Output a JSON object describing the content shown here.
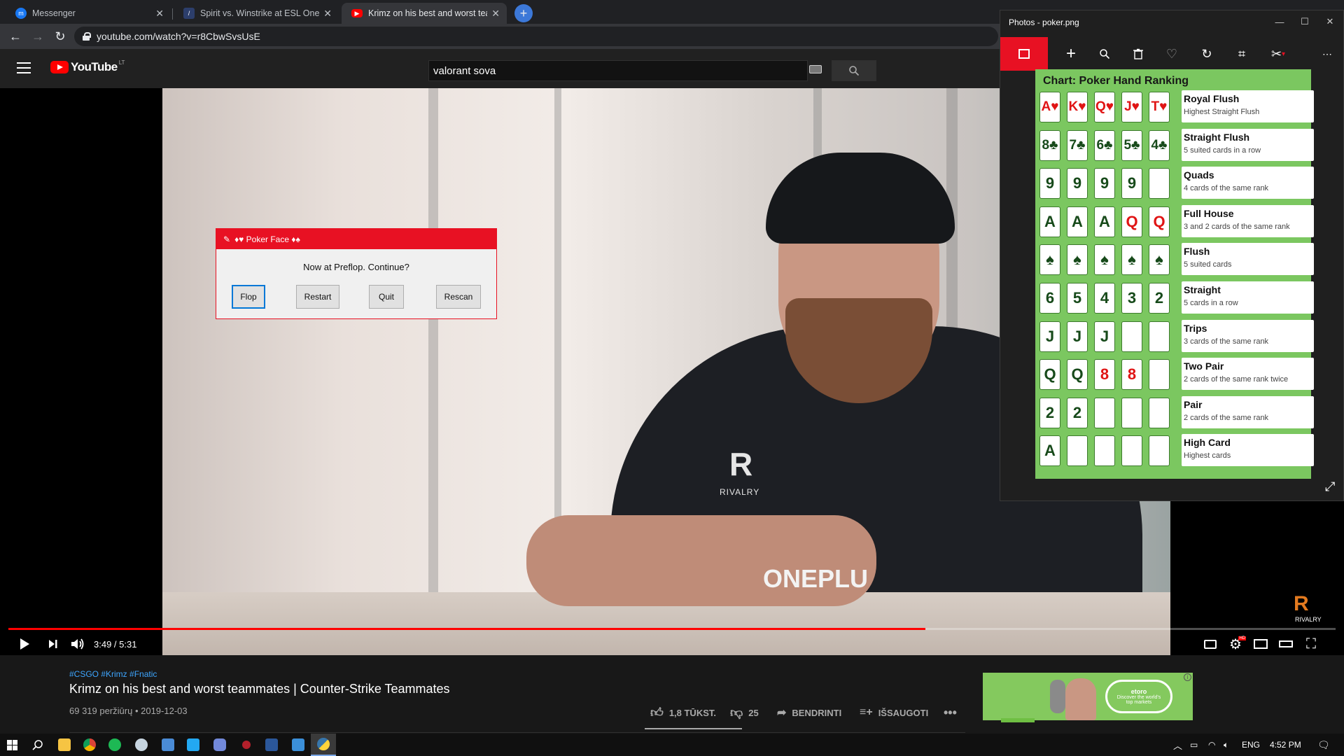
{
  "browser": {
    "tabs": [
      {
        "title": "Messenger",
        "icon": "messenger-icon",
        "active": false
      },
      {
        "title": "Spirit vs. Winstrike at ESL One: R",
        "icon": "hltv-icon",
        "active": false
      },
      {
        "title": "Krimz on his best and worst team",
        "icon": "youtube-icon",
        "active": true
      }
    ],
    "url": "youtube.com/watch?v=r8CbwSvsUsE"
  },
  "youtube": {
    "logo_text": "YouTube",
    "region": "LT",
    "search_value": "valorant sova",
    "player": {
      "time": "3:49 / 5:31",
      "progress": 0.691,
      "shirt_logo": "R",
      "shirt_text": "RIVALRY",
      "shirt_sponsor": "ONEPLU",
      "watermark_logo": "R",
      "watermark_text": "RIVALRY"
    },
    "video": {
      "tags": "#CSGO #Krimz #Fnatic",
      "title": "Krimz on his best and worst teammates | Counter-Strike Teammates",
      "meta": "69 319 peržiūrų • 2019-12-03",
      "likes": "1,8 TŪKST.",
      "dislikes": "25",
      "share_label": "BENDRINTI",
      "save_label": "IŠSAUGOTI"
    },
    "ad": {
      "brand": "etoro",
      "tagline": "Discover the world's top markets"
    }
  },
  "dialog": {
    "title": "♦♥ Poker Face ♦♠",
    "message": "Now at Preflop. Continue?",
    "buttons": [
      "Flop",
      "Restart",
      "Quit",
      "Rescan"
    ]
  },
  "photos": {
    "title": "Photos - poker.png",
    "chart_title": "Chart: Poker Hand Ranking",
    "hands": [
      {
        "name": "Royal Flush",
        "desc": "Highest Straight Flush",
        "cards": [
          {
            "t": "A♥",
            "red": true
          },
          {
            "t": "K♥",
            "red": true
          },
          {
            "t": "Q♥",
            "red": true
          },
          {
            "t": "J♥",
            "red": true
          },
          {
            "t": "T♥",
            "red": true
          }
        ]
      },
      {
        "name": "Straight Flush",
        "desc": "5 suited cards in a row",
        "cards": [
          {
            "t": "8♣",
            "red": false
          },
          {
            "t": "7♣",
            "red": false
          },
          {
            "t": "6♣",
            "red": false
          },
          {
            "t": "5♣",
            "red": false
          },
          {
            "t": "4♣",
            "red": false
          }
        ]
      },
      {
        "name": "Quads",
        "desc": "4 cards of the same rank",
        "cards": [
          {
            "t": "9",
            "red": false
          },
          {
            "t": "9",
            "red": false
          },
          {
            "t": "9",
            "red": false
          },
          {
            "t": "9",
            "red": false
          },
          {
            "t": "",
            "red": false
          }
        ]
      },
      {
        "name": "Full House",
        "desc": "3 and 2 cards of the same rank",
        "cards": [
          {
            "t": "A",
            "red": false
          },
          {
            "t": "A",
            "red": false
          },
          {
            "t": "A",
            "red": false
          },
          {
            "t": "Q",
            "red": true
          },
          {
            "t": "Q",
            "red": true
          }
        ]
      },
      {
        "name": "Flush",
        "desc": "5 suited cards",
        "cards": [
          {
            "t": "♠",
            "red": false
          },
          {
            "t": "♠",
            "red": false
          },
          {
            "t": "♠",
            "red": false
          },
          {
            "t": "♠",
            "red": false
          },
          {
            "t": "♠",
            "red": false
          }
        ]
      },
      {
        "name": "Straight",
        "desc": "5 cards in a row",
        "cards": [
          {
            "t": "6",
            "red": false
          },
          {
            "t": "5",
            "red": false
          },
          {
            "t": "4",
            "red": false
          },
          {
            "t": "3",
            "red": false
          },
          {
            "t": "2",
            "red": false
          }
        ]
      },
      {
        "name": "Trips",
        "desc": "3 cards of the same rank",
        "cards": [
          {
            "t": "J",
            "red": false
          },
          {
            "t": "J",
            "red": false
          },
          {
            "t": "J",
            "red": false
          },
          {
            "t": "",
            "red": false
          },
          {
            "t": "",
            "red": false
          }
        ]
      },
      {
        "name": "Two Pair",
        "desc": "2 cards of the same rank twice",
        "cards": [
          {
            "t": "Q",
            "red": false
          },
          {
            "t": "Q",
            "red": false
          },
          {
            "t": "8",
            "red": true
          },
          {
            "t": "8",
            "red": true
          },
          {
            "t": "",
            "red": false
          }
        ]
      },
      {
        "name": "Pair",
        "desc": "2 cards of the same rank",
        "cards": [
          {
            "t": "2",
            "red": false
          },
          {
            "t": "2",
            "red": false
          },
          {
            "t": "",
            "red": false
          },
          {
            "t": "",
            "red": false
          },
          {
            "t": "",
            "red": false
          }
        ]
      },
      {
        "name": "High Card",
        "desc": "Highest cards",
        "cards": [
          {
            "t": "A",
            "red": false
          },
          {
            "t": "",
            "red": false
          },
          {
            "t": "",
            "red": false
          },
          {
            "t": "",
            "red": false
          },
          {
            "t": "",
            "red": false
          }
        ]
      }
    ]
  },
  "taskbar": {
    "language": "ENG",
    "clock": "4:52 PM"
  },
  "colors": {
    "accent_red": "#e81123",
    "youtube_red": "#ff0000",
    "chart_green": "#7bc760",
    "link_blue": "#3ea6ff"
  }
}
